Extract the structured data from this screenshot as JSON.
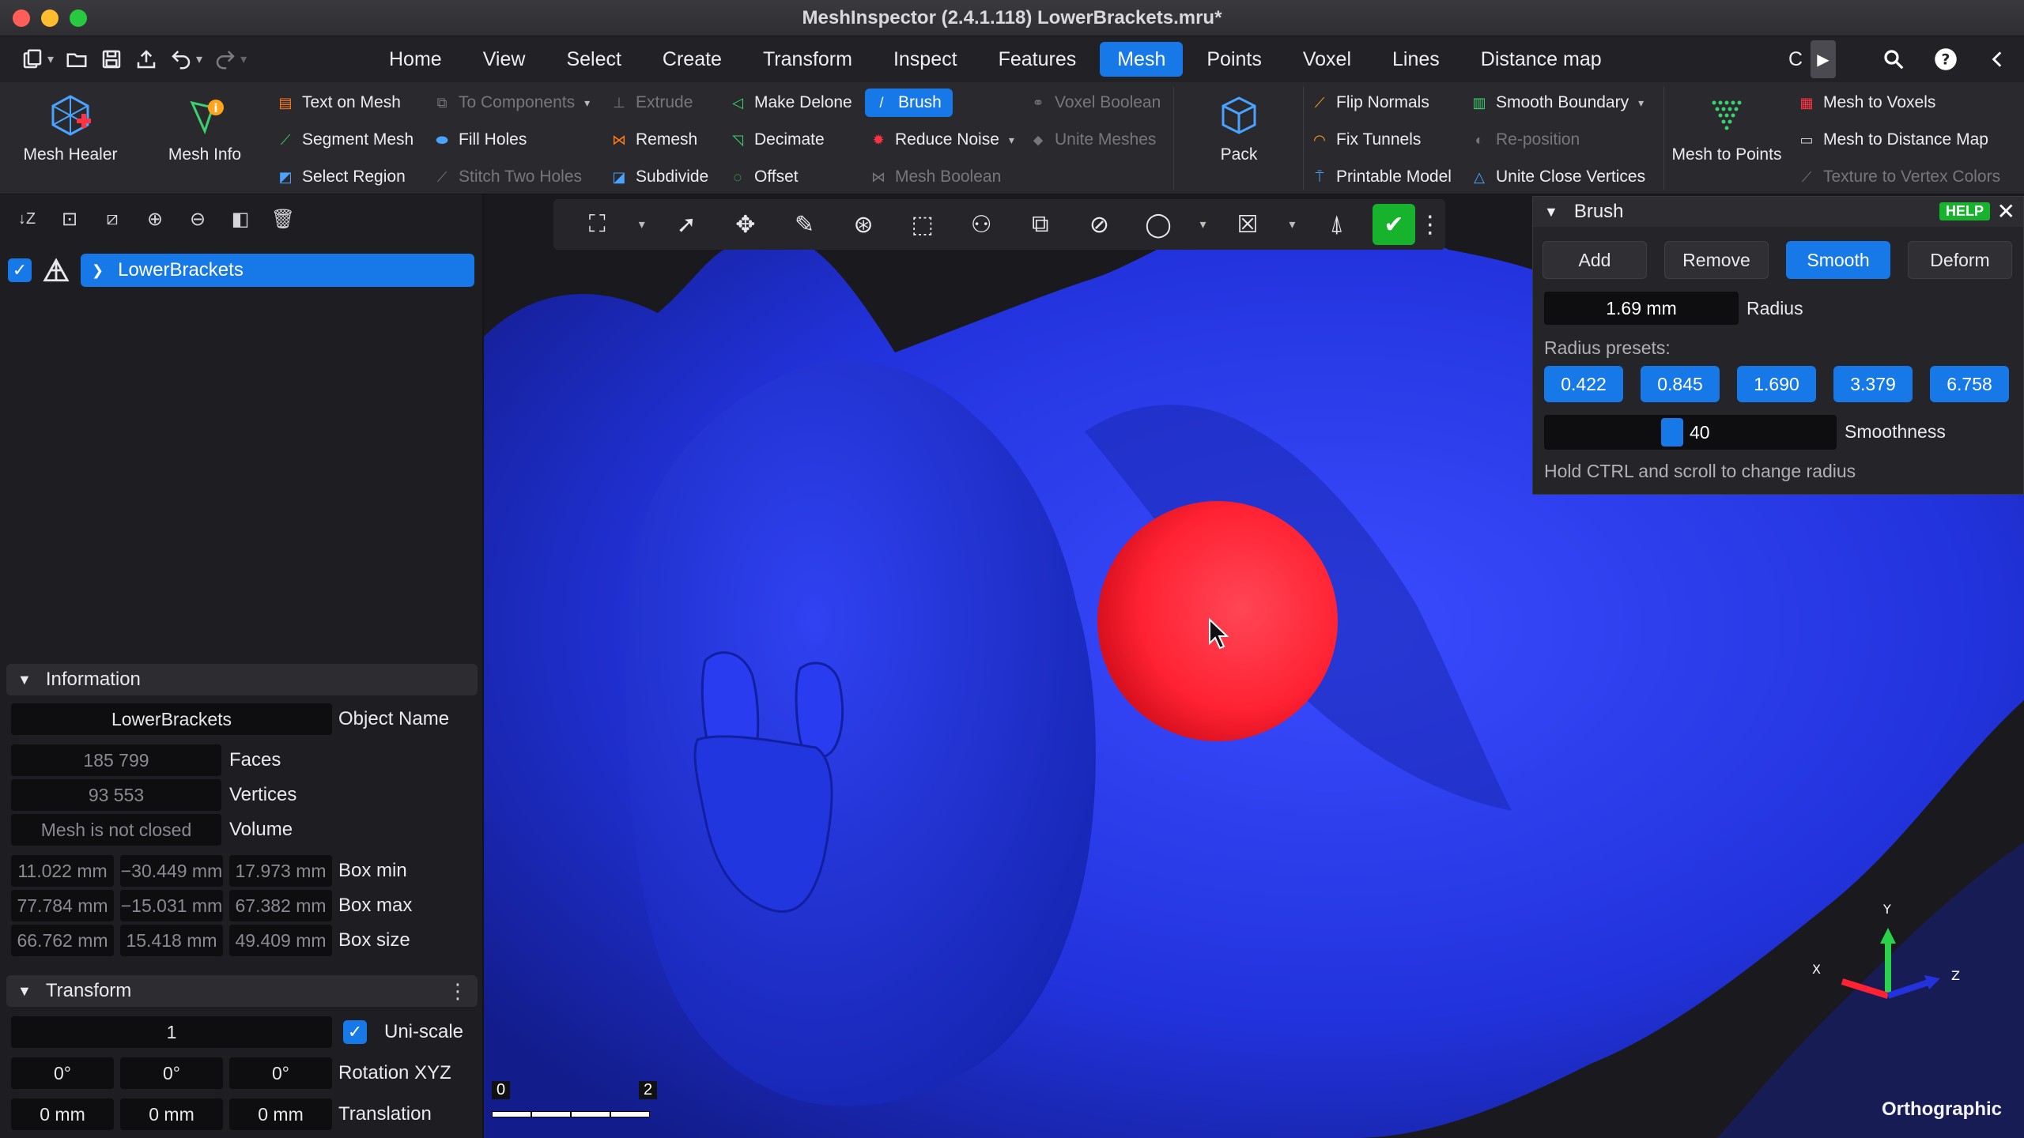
{
  "window": {
    "title": "MeshInspector (2.4.1.118) LowerBrackets.mru*",
    "traffic_colors": [
      "#ff5f57",
      "#febc2e",
      "#28c840"
    ]
  },
  "menu": {
    "tabs": [
      "Home",
      "View",
      "Select",
      "Create",
      "Transform",
      "Inspect",
      "Features",
      "Mesh",
      "Points",
      "Voxel",
      "Lines",
      "Distance map"
    ],
    "active_tab": "Mesh",
    "overflow_tab": "C"
  },
  "ribbon": {
    "mesh_healer": "Mesh Healer",
    "mesh_info": "Mesh Info",
    "text_on_mesh": "Text on Mesh",
    "segment_mesh": "Segment Mesh",
    "select_region": "Select Region",
    "to_components": "To Components",
    "fill_holes": "Fill Holes",
    "stitch_two_holes": "Stitch Two Holes",
    "extrude": "Extrude",
    "remesh": "Remesh",
    "subdivide": "Subdivide",
    "make_delone": "Make Delone",
    "decimate": "Decimate",
    "offset": "Offset",
    "brush": "Brush",
    "reduce_noise": "Reduce Noise",
    "mesh_boolean": "Mesh Boolean",
    "voxel_boolean": "Voxel Boolean",
    "unite_meshes": "Unite Meshes",
    "pack": "Pack",
    "flip_normals": "Flip Normals",
    "fix_tunnels": "Fix Tunnels",
    "printable_model": "Printable Model",
    "smooth_boundary": "Smooth Boundary",
    "re_position": "Re-position",
    "unite_close_vertices": "Unite Close Vertices",
    "mesh_to_points": "Mesh to Points",
    "mesh_to_voxels": "Mesh to Voxels",
    "mesh_to_distance_map": "Mesh to Distance Map",
    "texture_to_vertex_colors": "Texture to Vertex Colors"
  },
  "scene_tree": {
    "object_name": "LowerBrackets"
  },
  "information": {
    "header": "Information",
    "object_name_value": "LowerBrackets",
    "object_name_label": "Object Name",
    "faces_value": "185 799",
    "faces_label": "Faces",
    "vertices_value": "93 553",
    "vertices_label": "Vertices",
    "volume_value": "Mesh is not closed",
    "volume_label": "Volume",
    "box_min": [
      "11.022 mm",
      "−30.449 mm",
      "17.973 mm"
    ],
    "box_min_label": "Box min",
    "box_max": [
      "77.784 mm",
      "−15.031 mm",
      "67.382 mm"
    ],
    "box_max_label": "Box max",
    "box_size": [
      "66.762 mm",
      "15.418 mm",
      "49.409 mm"
    ],
    "box_size_label": "Box size"
  },
  "transform": {
    "header": "Transform",
    "scale_value": "1",
    "uniscale_label": "Uni-scale",
    "rotation": [
      "0°",
      "0°",
      "0°"
    ],
    "rotation_label": "Rotation XYZ",
    "translation": [
      "0 mm",
      "0 mm",
      "0 mm"
    ],
    "translation_label": "Translation"
  },
  "brush_panel": {
    "title": "Brush",
    "help": "HELP",
    "modes": [
      "Add",
      "Remove",
      "Smooth",
      "Deform"
    ],
    "active_mode": "Smooth",
    "radius_value": "1.69 mm",
    "radius_label": "Radius",
    "presets_label": "Radius presets:",
    "presets": [
      "0.422",
      "0.845",
      "1.690",
      "3.379",
      "6.758"
    ],
    "smoothness_value": "40",
    "smoothness_fraction": 0.4,
    "smoothness_label": "Smoothness",
    "hint": "Hold CTRL and scroll to change radius"
  },
  "viewport": {
    "projection": "Orthographic",
    "scale_start": "0",
    "scale_end": "2",
    "axis_x": "X",
    "axis_y": "Y",
    "axis_z": "Z",
    "mesh_color": "#2233dd",
    "brush_color": "#ff2233"
  },
  "colors": {
    "accent": "#1778e8",
    "ok_green": "#17b32c"
  }
}
